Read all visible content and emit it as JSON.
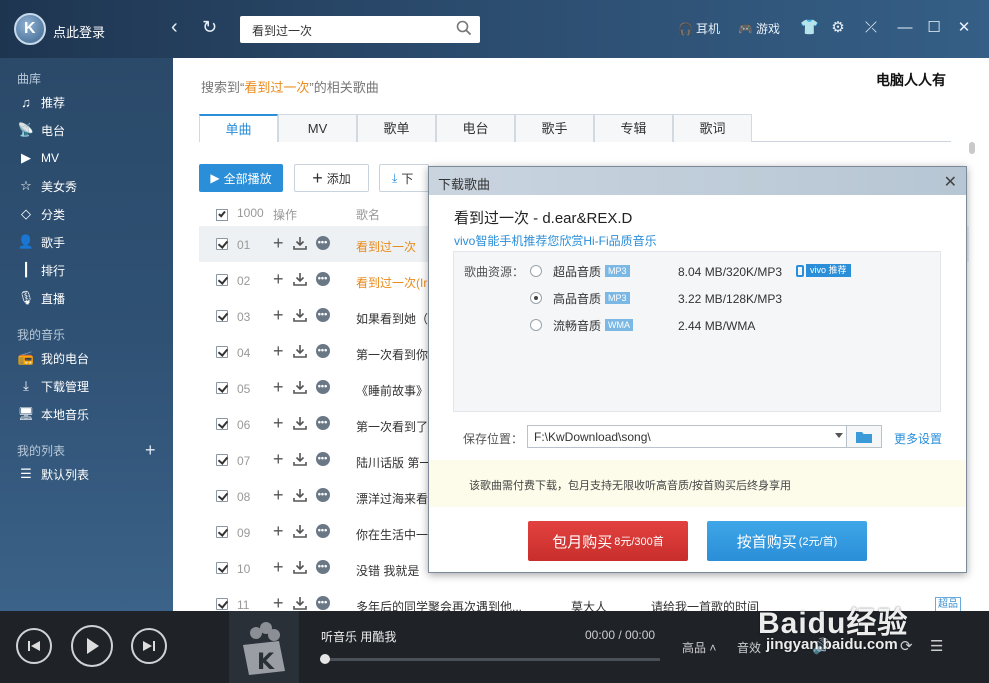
{
  "topbar": {
    "login": "点此登录",
    "search_value": "看到过一次",
    "headphones": "耳机",
    "games": "游戏"
  },
  "sidebar": {
    "sec_library": "曲库",
    "library": [
      {
        "label": "推荐",
        "icon": "music-note-icon"
      },
      {
        "label": "电台",
        "icon": "radio-icon"
      },
      {
        "label": "MV",
        "icon": "mv-icon"
      },
      {
        "label": "美女秀",
        "icon": "star-icon"
      },
      {
        "label": "分类",
        "icon": "tag-icon"
      },
      {
        "label": "歌手",
        "icon": "person-icon"
      },
      {
        "label": "排行",
        "icon": "chart-icon"
      },
      {
        "label": "直播",
        "icon": "mic-icon"
      }
    ],
    "sec_mymusic": "我的音乐",
    "mymusic": [
      {
        "label": "我的电台",
        "icon": "my-radio-icon"
      },
      {
        "label": "下载管理",
        "icon": "download-icon"
      },
      {
        "label": "本地音乐",
        "icon": "monitor-icon"
      }
    ],
    "sec_lists": "我的列表",
    "lists": [
      {
        "label": "默认列表",
        "icon": "list-icon"
      }
    ]
  },
  "main": {
    "brand_text": "电脑人人有",
    "result_prefix": "搜索到“",
    "result_keyword": "看到过一次",
    "result_suffix": "”的相关歌曲",
    "tabs": [
      "单曲",
      "MV",
      "歌单",
      "电台",
      "歌手",
      "专辑",
      "歌词"
    ],
    "play_all": "全部播放",
    "add": "添加",
    "download": "下",
    "head_count": "1000",
    "head_ops": "操作",
    "head_name": "歌名",
    "rows": [
      {
        "idx": "01",
        "name": "看到过一次",
        "orange": true
      },
      {
        "idx": "02",
        "name": "看到过一次(Ir",
        "orange": true
      },
      {
        "idx": "03",
        "name": "如果看到她（"
      },
      {
        "idx": "04",
        "name": "第一次看到你"
      },
      {
        "idx": "05",
        "name": "《睡前故事》"
      },
      {
        "idx": "06",
        "name": "第一次看到了"
      },
      {
        "idx": "07",
        "name": "陆川话版 第一"
      },
      {
        "idx": "08",
        "name": "漂洋过海来看"
      },
      {
        "idx": "09",
        "name": "你在生活中一"
      },
      {
        "idx": "10",
        "name": "没错 我就是"
      },
      {
        "idx": "11",
        "name": "多年后的同学聚会再次遇到他...",
        "artist": "莫大人",
        "album": "请给我一首歌的时间",
        "tag": "超品"
      }
    ]
  },
  "player": {
    "title": "听音乐 用酷我",
    "time": "00:00 / 00:00",
    "progress": 0,
    "quality": "高品",
    "effect": "音效"
  },
  "watermark": {
    "brand": "Baidu经验",
    "url": "jingyan.baidu.com"
  },
  "dialog": {
    "title": "下载歌曲",
    "song": "看到过一次 - d.ear&REX.D",
    "ad": "vivo智能手机推荐您欣赏Hi-Fi品质音乐",
    "source_label": "歌曲资源：",
    "qualities": [
      {
        "label": "超品音质",
        "format": "MP3",
        "size": "8.04 MB/320K/MP3",
        "selected": false,
        "badge": "vivo 推荐"
      },
      {
        "label": "高品音质",
        "format": "MP3",
        "size": "3.22 MB/128K/MP3",
        "selected": true
      },
      {
        "label": "流畅音质",
        "format": "WMA",
        "size": "2.44 MB/WMA",
        "selected": false
      }
    ],
    "save_label": "保存位置：",
    "save_path": "F:\\KwDownload\\song\\",
    "more_settings": "更多设置",
    "notice": "该歌曲需付费下载，包月支持无限收听高音质/按首购买后终身享用",
    "btn_month": "包月购买",
    "btn_month_price": "8元/300首",
    "btn_single": "按首购买",
    "btn_single_price": "(2元/首)"
  }
}
